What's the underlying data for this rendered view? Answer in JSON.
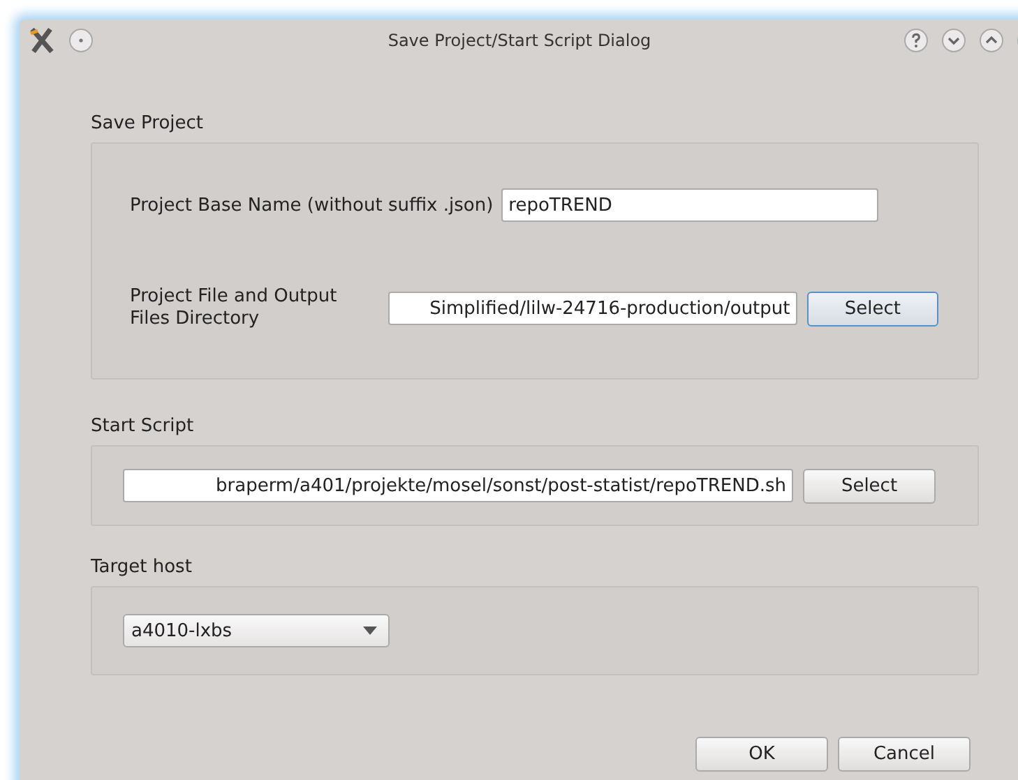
{
  "window": {
    "title": "Save Project/Start Script Dialog"
  },
  "save_project": {
    "title": "Save Project",
    "base_name": {
      "label": "Project Base Name (without suffix .json)",
      "value": "repoTREND"
    },
    "directory": {
      "label": "Project File and Output Files Directory",
      "value": "Simplified/lilw-24716-production/output",
      "button": {
        "label": "Select",
        "focused": true
      }
    }
  },
  "start_script": {
    "title": "Start Script",
    "value": "braperm/a401/projekte/mosel/sonst/post-statist/repoTREND.sh",
    "button": {
      "label": "Select",
      "focused": false
    }
  },
  "target_host": {
    "title": "Target host",
    "value": "a4010-lxbs"
  },
  "buttons": [
    {
      "label": "OK"
    },
    {
      "label": "Cancel"
    }
  ]
}
